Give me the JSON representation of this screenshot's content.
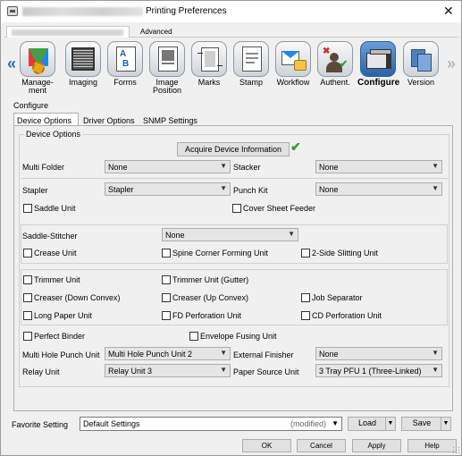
{
  "window": {
    "title": "Printing Preferences",
    "close_glyph": "✕",
    "tabs": [
      {
        "label": "",
        "selected": true
      },
      {
        "label": "Advanced",
        "selected": false
      }
    ]
  },
  "toolbar": {
    "left_arrow": "«",
    "right_arrow": "»",
    "items": [
      {
        "label": "Manage-\nment",
        "icon": "management-icon"
      },
      {
        "label": "Imaging",
        "icon": "imaging-icon"
      },
      {
        "label": "Forms",
        "icon": "forms-icon"
      },
      {
        "label": "Image\nPosition",
        "icon": "image-position-icon"
      },
      {
        "label": "Marks",
        "icon": "marks-icon"
      },
      {
        "label": "Stamp",
        "icon": "stamp-icon"
      },
      {
        "label": "Workflow",
        "icon": "workflow-icon"
      },
      {
        "label": "Authent.",
        "icon": "authentication-icon"
      },
      {
        "label": "Configure",
        "icon": "configure-icon",
        "selected": true
      },
      {
        "label": "Version",
        "icon": "version-icon"
      }
    ]
  },
  "configure": {
    "label": "Configure",
    "subtabs": [
      "Device Options",
      "Driver Options",
      "SNMP Settings"
    ],
    "group_title": "Device Options",
    "acquire_button": "Acquire Device Information",
    "acquire_status_icon": "checkmark-icon",
    "multi_folder": {
      "label": "Multi Folder",
      "value": "None"
    },
    "stacker": {
      "label": "Stacker",
      "value": "None"
    },
    "stapler": {
      "label": "Stapler",
      "value": "Stapler"
    },
    "punch_kit": {
      "label": "Punch Kit",
      "value": "None"
    },
    "saddle_unit": "Saddle Unit",
    "cover_sheet_feeder": "Cover Sheet Feeder",
    "saddle_stitcher": {
      "label": "Saddle-Stitcher",
      "value": "None"
    },
    "crease_unit": "Crease Unit",
    "spine_corner_forming_unit": "Spine Corner Forming Unit",
    "two_side_slitting_unit": "2-Side Slitting Unit",
    "trimmer_unit": "Trimmer Unit",
    "trimmer_unit_gutter": "Trimmer Unit (Gutter)",
    "creaser_down": "Creaser (Down Convex)",
    "creaser_up": "Creaser (Up Convex)",
    "job_separator": "Job Separator",
    "long_paper_unit": "Long Paper Unit",
    "fd_perforation_unit": "FD Perforation Unit",
    "cd_perforation_unit": "CD Perforation Unit",
    "perfect_binder": "Perfect Binder",
    "envelope_fusing_unit": "Envelope Fusing Unit",
    "multi_hole_punch_unit": {
      "label": "Multi Hole Punch Unit",
      "value": "Multi Hole Punch Unit 2"
    },
    "external_finisher": {
      "label": "External Finisher",
      "value": "None"
    },
    "relay_unit": {
      "label": "Relay Unit",
      "value": "Relay Unit 3"
    },
    "paper_source_unit": {
      "label": "Paper Source Unit",
      "value": "3 Tray PFU 1 (Three-Linked)"
    }
  },
  "favorite": {
    "label": "Favorite Setting",
    "value": "Default Settings",
    "modified": "(modified)",
    "load": "Load",
    "save": "Save"
  },
  "footer": {
    "ok": "OK",
    "cancel": "Cancel",
    "apply": "Apply",
    "help": "Help"
  },
  "colors": {
    "accent": "#2b62a6",
    "check_green": "#29a329"
  }
}
